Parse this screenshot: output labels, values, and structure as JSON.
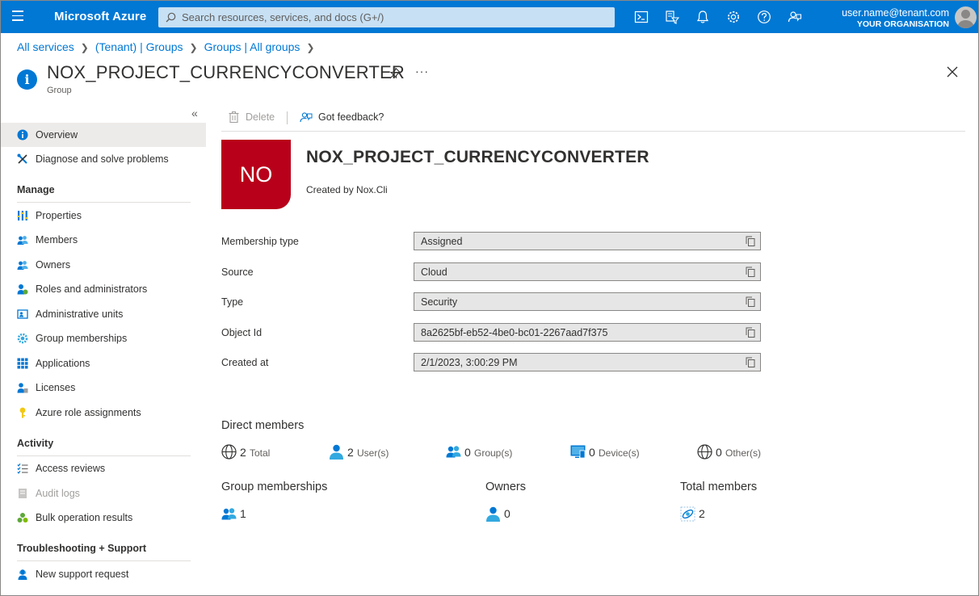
{
  "topbar": {
    "brand": "Microsoft Azure",
    "search_placeholder": "Search resources, services, and docs (G+/)",
    "user_name": "user.name@tenant.com",
    "user_org": "YOUR ORGANISATION",
    "icons": [
      "cloud-shell-icon",
      "directory-filter-icon",
      "notifications-icon",
      "settings-icon",
      "help-icon",
      "feedback-icon"
    ]
  },
  "breadcrumb": [
    "All services",
    "(Tenant) | Groups",
    "Groups | All groups"
  ],
  "header": {
    "title": "NOX_PROJECT_CURRENCYCONVERTER",
    "subtitle": "Group",
    "more": "···"
  },
  "sidebar": {
    "top_items": [
      {
        "label": "Overview",
        "icon": "info-icon",
        "active": true
      },
      {
        "label": "Diagnose and solve problems",
        "icon": "wrench-icon"
      }
    ],
    "sections": [
      {
        "title": "Manage",
        "items": [
          {
            "label": "Properties",
            "icon": "properties-icon"
          },
          {
            "label": "Members",
            "icon": "members-icon"
          },
          {
            "label": "Owners",
            "icon": "owners-icon"
          },
          {
            "label": "Roles and administrators",
            "icon": "roles-icon"
          },
          {
            "label": "Administrative units",
            "icon": "admin-units-icon"
          },
          {
            "label": "Group memberships",
            "icon": "gear-icon"
          },
          {
            "label": "Applications",
            "icon": "applications-icon"
          },
          {
            "label": "Licenses",
            "icon": "licenses-icon"
          },
          {
            "label": "Azure role assignments",
            "icon": "key-icon"
          }
        ]
      },
      {
        "title": "Activity",
        "items": [
          {
            "label": "Access reviews",
            "icon": "checklist-icon"
          },
          {
            "label": "Audit logs",
            "icon": "audit-logs-icon",
            "disabled": true
          },
          {
            "label": "Bulk operation results",
            "icon": "bulk-results-icon"
          }
        ]
      },
      {
        "title": "Troubleshooting + Support",
        "items": [
          {
            "label": "New support request",
            "icon": "support-request-icon"
          }
        ]
      }
    ]
  },
  "commands": {
    "delete": "Delete",
    "feedback": "Got feedback?"
  },
  "group": {
    "initials": "NO",
    "name": "NOX_PROJECT_CURRENCYCONVERTER",
    "created_by": "Created by Nox.Cli",
    "tile_color": "#b8001a"
  },
  "properties": [
    {
      "label": "Membership type",
      "value": "Assigned"
    },
    {
      "label": "Source",
      "value": "Cloud"
    },
    {
      "label": "Type",
      "value": "Security"
    },
    {
      "label": "Object Id",
      "value": "8a2625bf-eb52-4be0-bc01-2267aad7f375"
    },
    {
      "label": "Created at",
      "value": "2/1/2023, 3:00:29 PM"
    }
  ],
  "direct_members": {
    "heading": "Direct members",
    "stats": [
      {
        "value": "2",
        "label": "Total",
        "icon": "globe-icon"
      },
      {
        "value": "2",
        "label": "User(s)",
        "icon": "user-icon"
      },
      {
        "value": "0",
        "label": "Group(s)",
        "icon": "group-icon"
      },
      {
        "value": "0",
        "label": "Device(s)",
        "icon": "device-icon"
      },
      {
        "value": "0",
        "label": "Other(s)",
        "icon": "globe-icon"
      }
    ]
  },
  "summary": [
    {
      "heading": "Group memberships",
      "value": "1",
      "icon": "group-icon"
    },
    {
      "heading": "Owners",
      "value": "0",
      "icon": "user-icon"
    },
    {
      "heading": "Total members",
      "value": "2",
      "icon": "total-members-icon"
    }
  ],
  "colors": {
    "accent": "#0078d4",
    "search_bg": "#c7e0f4"
  }
}
